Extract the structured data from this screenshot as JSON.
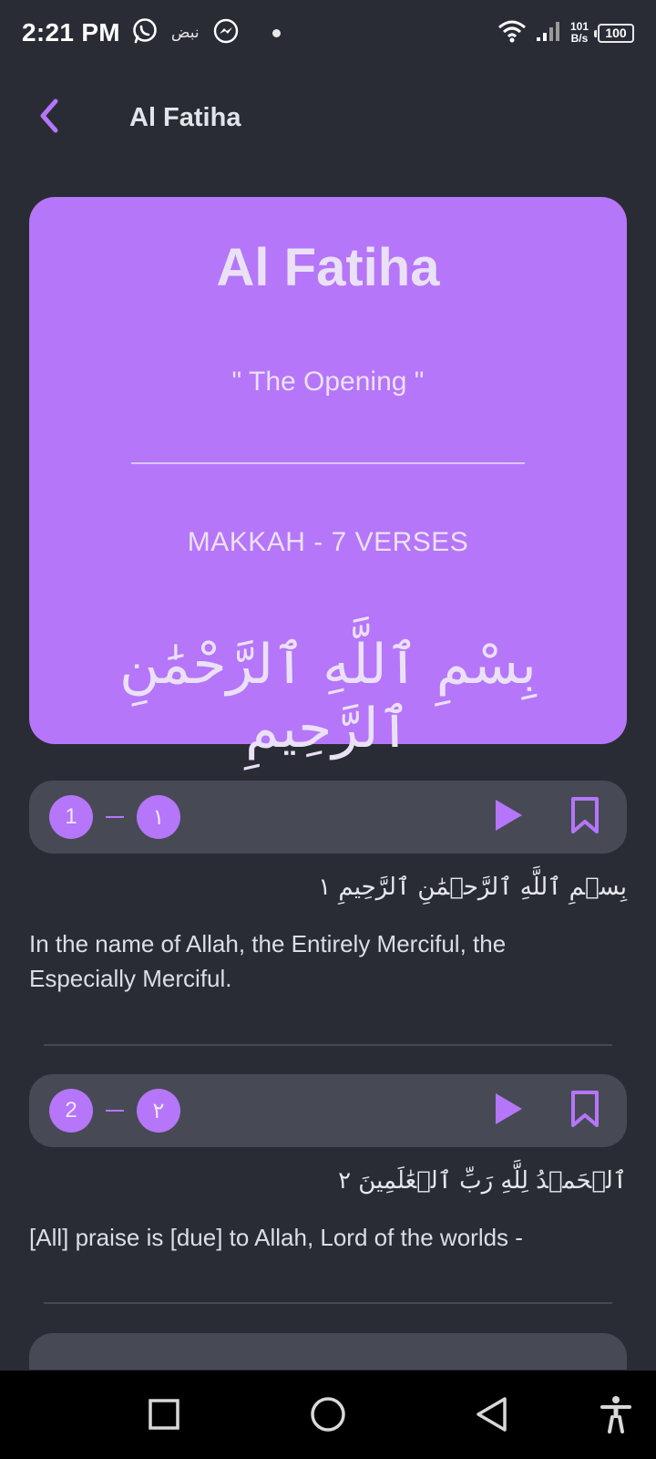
{
  "status_bar": {
    "time": "2:21 PM",
    "notification_text": "نبض",
    "net_speed_value": "101",
    "net_speed_unit": "B/s",
    "battery": "100"
  },
  "app_bar": {
    "title": "Al Fatiha",
    "back_icon": "chevron-left-icon"
  },
  "surah": {
    "name": "Al Fatiha",
    "meaning": "\" The Opening \"",
    "info": "MAKKAH - 7 VERSES",
    "bismillah": "بِسْمِ ٱللَّهِ ٱلرَّحْمَٰنِ ٱلرَّحِيمِ"
  },
  "verses": [
    {
      "number": "1",
      "number_arabic": "١",
      "arabic": "بِسۡمِ ٱللَّهِ ٱلرَّحۡمَٰنِ ٱلرَّحِيمِ ١",
      "translation": "In the name of Allah, the Entirely Merciful, the Especially Merciful."
    },
    {
      "number": "2",
      "number_arabic": "٢",
      "arabic": "ٱلۡحَمۡدُ لِلَّهِ رَبِّ ٱلۡعَٰلَمِينَ ٢",
      "translation": "[All] praise is [due] to Allah, Lord of the worlds -"
    }
  ],
  "colors": {
    "accent": "#b576f9",
    "background": "#292c35",
    "verse_bar": "#474a54"
  },
  "icons": {
    "play": "play-icon",
    "bookmark": "bookmark-icon",
    "nav_recents": "square-icon",
    "nav_home": "circle-icon",
    "nav_back": "triangle-back-icon",
    "accessibility": "accessibility-icon"
  }
}
